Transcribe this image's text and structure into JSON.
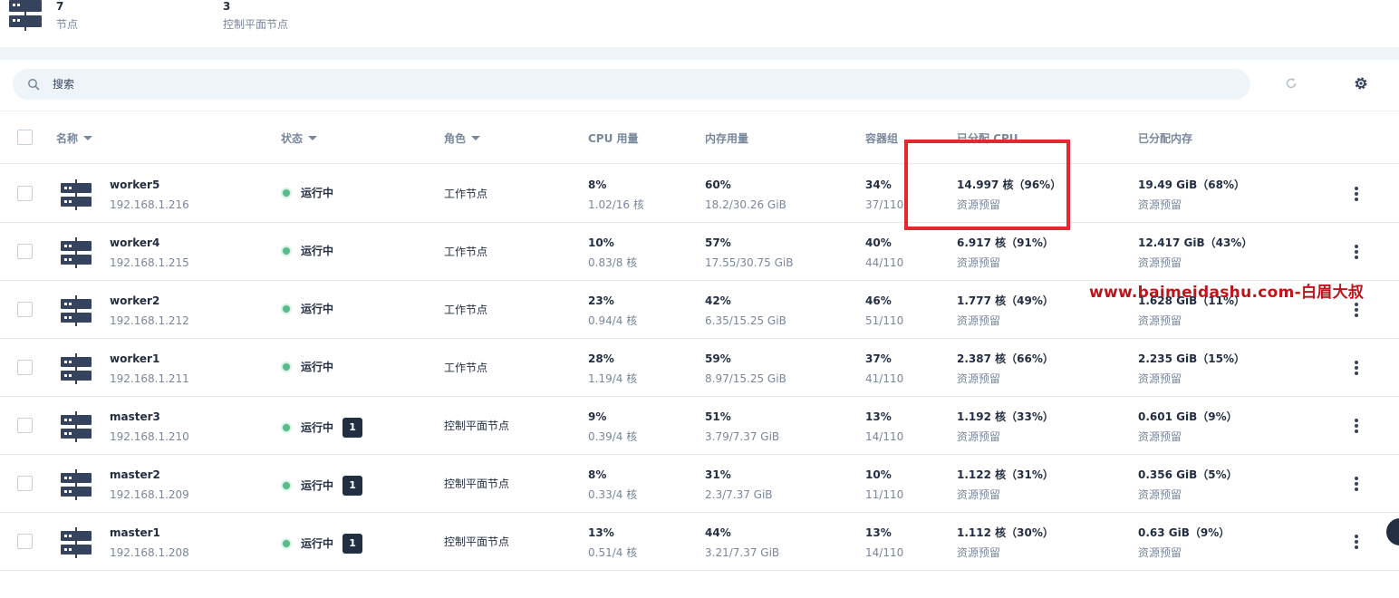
{
  "summary": {
    "nodes": {
      "value": "7",
      "label": "节点"
    },
    "control_plane": {
      "value": "3",
      "label": "控制平面节点"
    }
  },
  "search": {
    "placeholder": "搜索"
  },
  "table": {
    "headers": {
      "name": "名称",
      "status": "状态",
      "role": "角色",
      "cpu": "CPU 用量",
      "memory": "内存用量",
      "pods": "容器组",
      "alloc_cpu": "已分配 CPU",
      "alloc_mem": "已分配内存"
    },
    "rows": [
      {
        "name": "worker5",
        "ip": "192.168.1.216",
        "status": "运行中",
        "badge": "",
        "role": "工作节点",
        "cpu_pct": "8%",
        "cpu_detail": "1.02/16 核",
        "mem_pct": "60%",
        "mem_detail": "18.2/30.26 GiB",
        "pods_pct": "34%",
        "pods_detail": "37/110",
        "alloc_cpu": "14.997 核（96%）",
        "alloc_cpu_sub": "资源预留",
        "alloc_mem": "19.49 GiB（68%）",
        "alloc_mem_sub": "资源预留"
      },
      {
        "name": "worker4",
        "ip": "192.168.1.215",
        "status": "运行中",
        "badge": "",
        "role": "工作节点",
        "cpu_pct": "10%",
        "cpu_detail": "0.83/8 核",
        "mem_pct": "57%",
        "mem_detail": "17.55/30.75 GiB",
        "pods_pct": "40%",
        "pods_detail": "44/110",
        "alloc_cpu": "6.917 核（91%）",
        "alloc_cpu_sub": "资源预留",
        "alloc_mem": "12.417 GiB（43%）",
        "alloc_mem_sub": "资源预留"
      },
      {
        "name": "worker2",
        "ip": "192.168.1.212",
        "status": "运行中",
        "badge": "",
        "role": "工作节点",
        "cpu_pct": "23%",
        "cpu_detail": "0.94/4 核",
        "mem_pct": "42%",
        "mem_detail": "6.35/15.25 GiB",
        "pods_pct": "46%",
        "pods_detail": "51/110",
        "alloc_cpu": "1.777 核（49%）",
        "alloc_cpu_sub": "资源预留",
        "alloc_mem": "1.628 GiB（11%）",
        "alloc_mem_sub": "资源预留"
      },
      {
        "name": "worker1",
        "ip": "192.168.1.211",
        "status": "运行中",
        "badge": "",
        "role": "工作节点",
        "cpu_pct": "28%",
        "cpu_detail": "1.19/4 核",
        "mem_pct": "59%",
        "mem_detail": "8.97/15.25 GiB",
        "pods_pct": "37%",
        "pods_detail": "41/110",
        "alloc_cpu": "2.387 核（66%）",
        "alloc_cpu_sub": "资源预留",
        "alloc_mem": "2.235 GiB（15%）",
        "alloc_mem_sub": "资源预留"
      },
      {
        "name": "master3",
        "ip": "192.168.1.210",
        "status": "运行中",
        "badge": "1",
        "role": "控制平面节点",
        "cpu_pct": "9%",
        "cpu_detail": "0.39/4 核",
        "mem_pct": "51%",
        "mem_detail": "3.79/7.37 GiB",
        "pods_pct": "13%",
        "pods_detail": "14/110",
        "alloc_cpu": "1.192 核（33%）",
        "alloc_cpu_sub": "资源预留",
        "alloc_mem": "0.601 GiB（9%）",
        "alloc_mem_sub": "资源预留"
      },
      {
        "name": "master2",
        "ip": "192.168.1.209",
        "status": "运行中",
        "badge": "1",
        "role": "控制平面节点",
        "cpu_pct": "8%",
        "cpu_detail": "0.33/4 核",
        "mem_pct": "31%",
        "mem_detail": "2.3/7.37 GiB",
        "pods_pct": "10%",
        "pods_detail": "11/110",
        "alloc_cpu": "1.122 核（31%）",
        "alloc_cpu_sub": "资源预留",
        "alloc_mem": "0.356 GiB（5%）",
        "alloc_mem_sub": "资源预留"
      },
      {
        "name": "master1",
        "ip": "192.168.1.208",
        "status": "运行中",
        "badge": "1",
        "role": "控制平面节点",
        "cpu_pct": "13%",
        "cpu_detail": "0.51/4 核",
        "mem_pct": "44%",
        "mem_detail": "3.21/7.37 GiB",
        "pods_pct": "13%",
        "pods_detail": "14/110",
        "alloc_cpu": "1.112 核（30%）",
        "alloc_cpu_sub": "资源预留",
        "alloc_mem": "0.63 GiB（9%）",
        "alloc_mem_sub": "资源预留"
      }
    ]
  },
  "watermark": "www.baimeidashu.com-白眉大叔",
  "colors": {
    "status_running": "#55bc8a",
    "highlight": "#e4282f",
    "watermark": "#c0141a"
  }
}
